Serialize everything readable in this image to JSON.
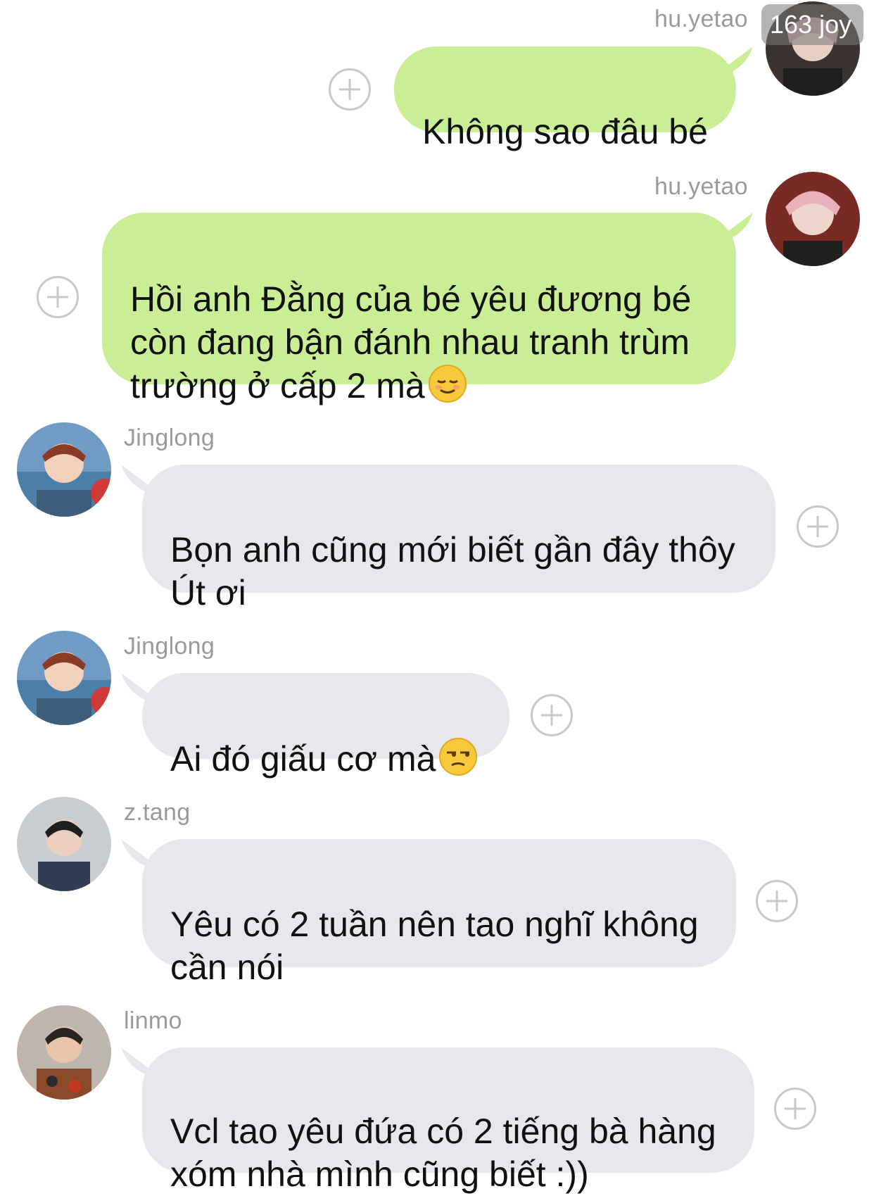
{
  "watermark": "163 joy",
  "messages": [
    {
      "sender": "hu.yetao",
      "direction": "out",
      "text": "Không sao đâu bé",
      "emoji": ""
    },
    {
      "sender": "hu.yetao",
      "direction": "out",
      "text": "Hồi anh Đằng của bé yêu đương bé\ncòn đang bận đánh nhau tranh trùm\ntrường ở cấp 2 mà",
      "emoji": "relieved-face-emoji"
    },
    {
      "sender": "Jinglong",
      "direction": "in",
      "text": "Bọn anh cũng mới biết gần đây thôy\nÚt ơi",
      "emoji": ""
    },
    {
      "sender": "Jinglong",
      "direction": "in",
      "text": "Ai đó giấu cơ mà",
      "emoji": "unamused-face-emoji"
    },
    {
      "sender": "z.tang",
      "direction": "in",
      "text": "Yêu có 2 tuần nên tao nghĩ không\ncần nói",
      "emoji": ""
    },
    {
      "sender": "linmo",
      "direction": "in",
      "text": "Vcl tao yêu đứa có 2 tiếng bà hàng\nxóm nhà mình cũng biết :))",
      "emoji": ""
    }
  ],
  "colors": {
    "outgoing_bubble": "#c9ee95",
    "incoming_bubble": "#e6e8ec",
    "sender_name": "#9a9a9a",
    "plus_icon": "#c8c8c8"
  }
}
